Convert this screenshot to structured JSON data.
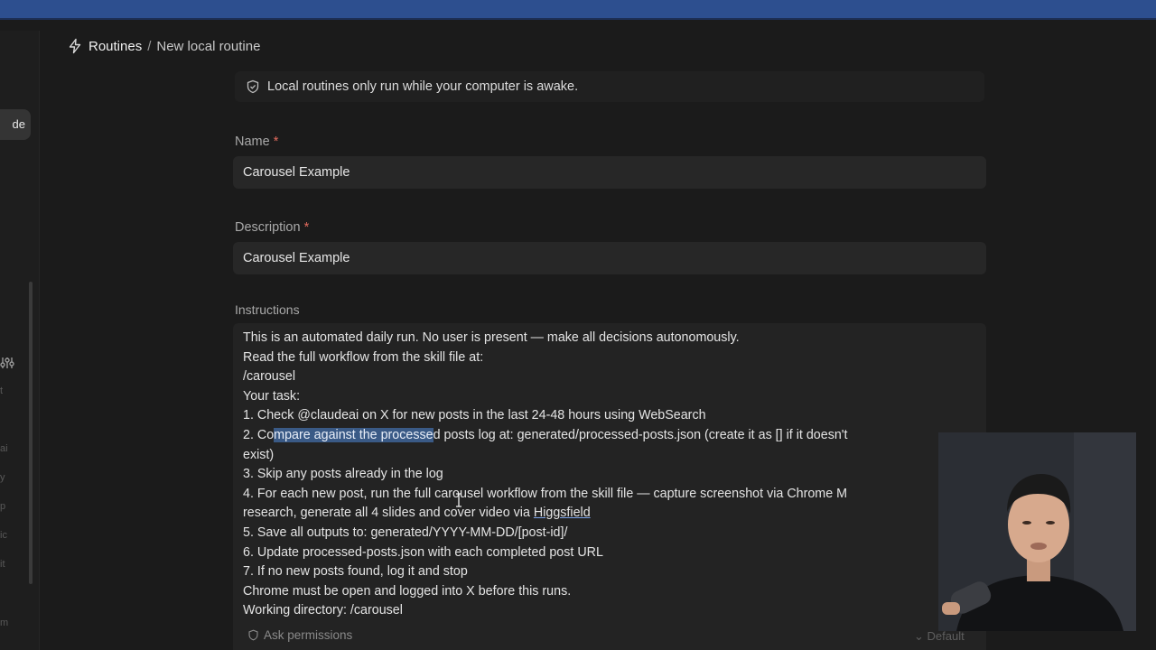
{
  "breadcrumb": {
    "section": "Routines",
    "separator": "/",
    "page": "New local routine"
  },
  "sidebar": {
    "active_item_fragment": "de",
    "ghost_fragments": [
      "t",
      "ai",
      "y",
      "p",
      "ic",
      "it",
      "m"
    ]
  },
  "notice": {
    "text": "Local routines only run while your computer is awake."
  },
  "form": {
    "name_label": "Name",
    "name_value": "Carousel Example",
    "description_label": "Description",
    "description_value": "Carousel Example",
    "required_mark": "*",
    "instructions_label": "Instructions",
    "instructions": {
      "line1": "This is an automated daily run. No user is present — make all decisions autonomously.",
      "line2": "Read the full workflow from the skill file at:",
      "line3": "/carousel",
      "line4": "Your task:",
      "line5": "1. Check @claudeai on X for new posts in the last 24-48 hours using WebSearch",
      "line6_a": "2. Co",
      "line6_hl": "mpare against the processe",
      "line6_b": "d posts log at: generated/processed-posts.json (create it as [] if it doesn't",
      "line7": "exist)",
      "line8": "3. Skip any posts already in the log",
      "line9": "4. For each new post, run the full carousel workflow from the skill file — capture screenshot via Chrome M",
      "line10_a": "research, generate all 4 slides and cover video via ",
      "line10_ul": "Higgsfield",
      "line11": "5. Save all outputs to: generated/YYYY-MM-DD/[post-id]/",
      "line12": "6. Update processed-posts.json with each completed post URL",
      "line13": "7. If no new posts found, log it and stop",
      "line14": "Chrome must be open and logged into X before this runs.",
      "line15": "Working directory: /carousel"
    }
  },
  "footer": {
    "permissions_label": "Ask permissions",
    "model_label": "Default"
  },
  "colors": {
    "accent_required": "#e26b5e",
    "selection": "#3a5a86",
    "top_bar": "#2d4f8f"
  }
}
